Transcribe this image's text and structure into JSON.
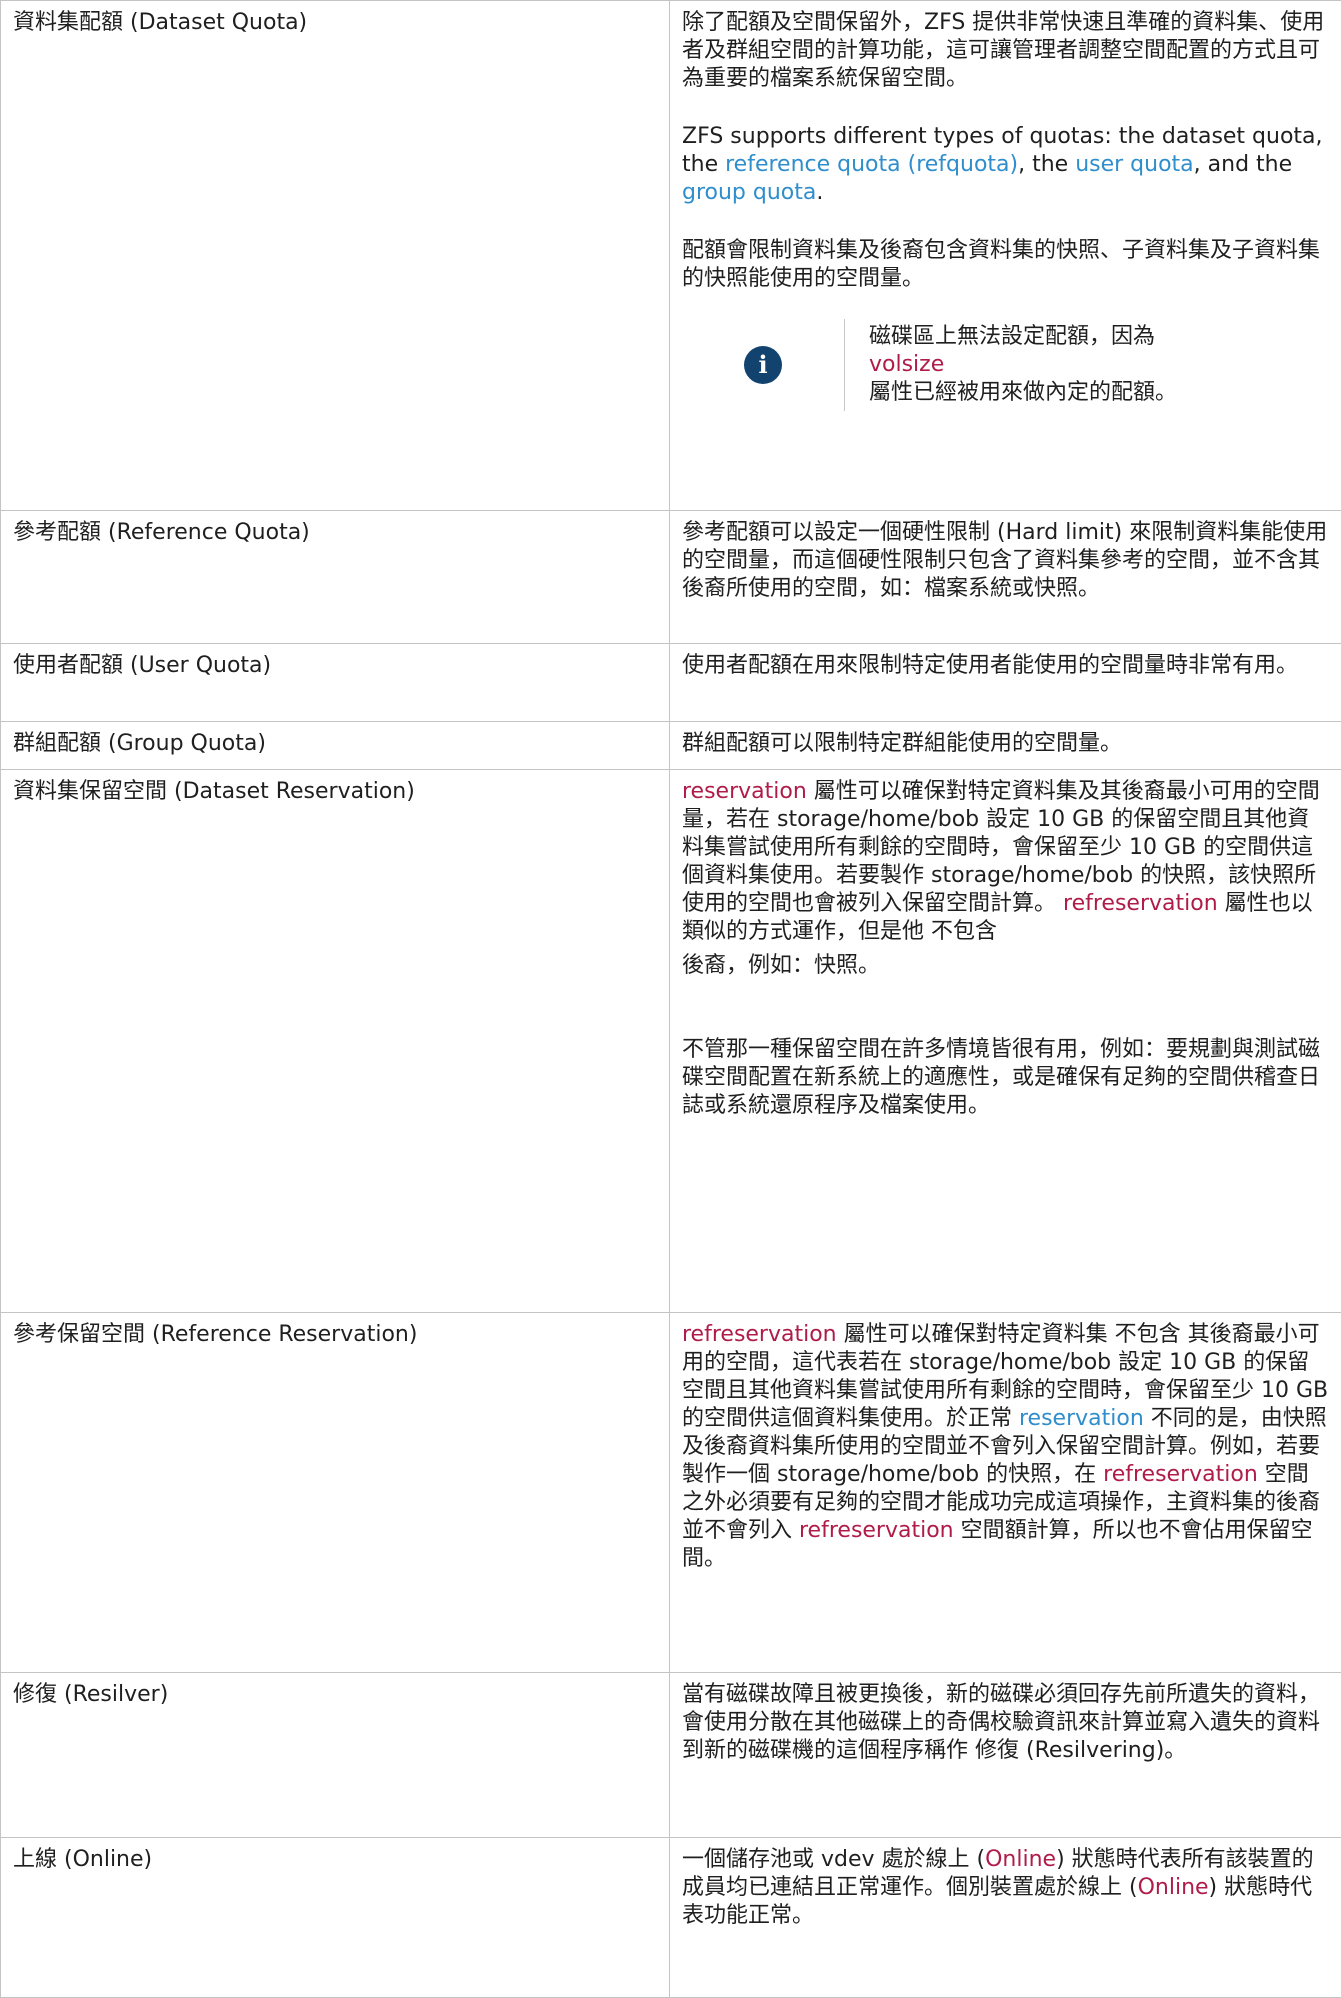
{
  "rows": [
    {
      "term": "資料集配額 (Dataset Quota)",
      "p1": "除了配額及空間保留外，ZFS 提供非常快速且準確的資料集、使用者及群組空間的計算功能，這可讓管理者調整空間配置的方式且可為重要的檔案系統保留空間。",
      "p2_a": "ZFS supports different types of quotas: the dataset quota, the ",
      "p2_link1": "reference quota (refquota)",
      "p2_b": ", the ",
      "p2_link2": "user quota",
      "p2_c": ", and the ",
      "p2_link3": "group quota",
      "p2_d": ".",
      "p3": "配額會限制資料集及後裔包含資料集的快照、子資料集及子資料集的快照能使用的空間量。",
      "note_a": "磁碟區上無法設定配額，因為",
      "note_code": "volsize",
      "note_b": "屬性已經被用來做內定的配額。",
      "note_icon": "info-icon"
    },
    {
      "term": "參考配額 (Reference Quota)",
      "desc": "參考配額可以設定一個硬性限制 (Hard limit) 來限制資料集能使用的空間量，而這個硬性限制只包含了資料集參考的空間，並不含其後裔所使用的空間，如：檔案系統或快照。"
    },
    {
      "term": "使用者配額 (User Quota)",
      "desc": "使用者配額在用來限制特定使用者能使用的空間量時非常有用。"
    },
    {
      "term": "群組配額 (Group Quota)",
      "desc": "群組配額可以限制特定群組能使用的空間量。"
    },
    {
      "term": "資料集保留空間 (Dataset Reservation)",
      "code1": "reservation",
      "t1": "屬性可以確保對特定資料集及其後裔最小可用的空間量，若在 storage/home/bob 設定 10 GB 的保留空間且其他資料集嘗試使用所有剩餘的空間時，會保留至少 10 GB 的空間供這個資料集使用。若要製作 storage/home/bob 的快照，該快照所使用的空間也會被列入保留空間計算。",
      "code2": "refreservation",
      "t2": "屬性也以類似的方式運作，但是他 不包含",
      "t3": "後裔，例如：快照。",
      "p2": "不管那一種保留空間在許多情境皆很有用，例如：要規劃與測試磁碟空間配置在新系統上的適應性，或是確保有足夠的空間供稽查日誌或系統還原程序及檔案使用。"
    },
    {
      "term": "參考保留空間 (Reference Reservation)",
      "code1": "refreservation",
      "t1": " 屬性可以確保對特定資料集 不包含 其後裔最小可用的空間，這代表若在 storage/home/bob 設定 10 GB 的保留空間且其他資料集嘗試使用所有剩餘的空間時，會保留至少 10 GB 的空間供這個資料集使用。於正常 ",
      "link1": "reservation",
      "t2": " 不同的是，由快照及後裔資料集所使用的空間並不會列入保留空間計算。例如，若要製作一個 storage/home/bob 的快照，在 ",
      "code2": "refreservation",
      "t3": " 空間之外必須要有足夠的空間才能成功完成這項操作，主資料集的後裔並不會列入 ",
      "code3": "refreservation",
      "t4": " 空間額計算，所以也不會佔用保留空間。"
    },
    {
      "term": "修復 (Resilver)",
      "desc": "當有磁碟故障且被更換後，新的磁碟必須回存先前所遺失的資料，會使用分散在其他磁碟上的奇偶校驗資訊來計算並寫入遺失的資料到新的磁碟機的這個程序稱作 修復 (Resilvering)。"
    },
    {
      "term": "上線 (Online)",
      "t1": "一個儲存池或 vdev 處於線上 (",
      "code1": "Online",
      "t2": ") 狀態時代表所有該裝置的成員均已連結且正常運作。個別裝置處於線上 (",
      "code2": "Online",
      "t3": ") 狀態時代表功能正常。"
    }
  ]
}
